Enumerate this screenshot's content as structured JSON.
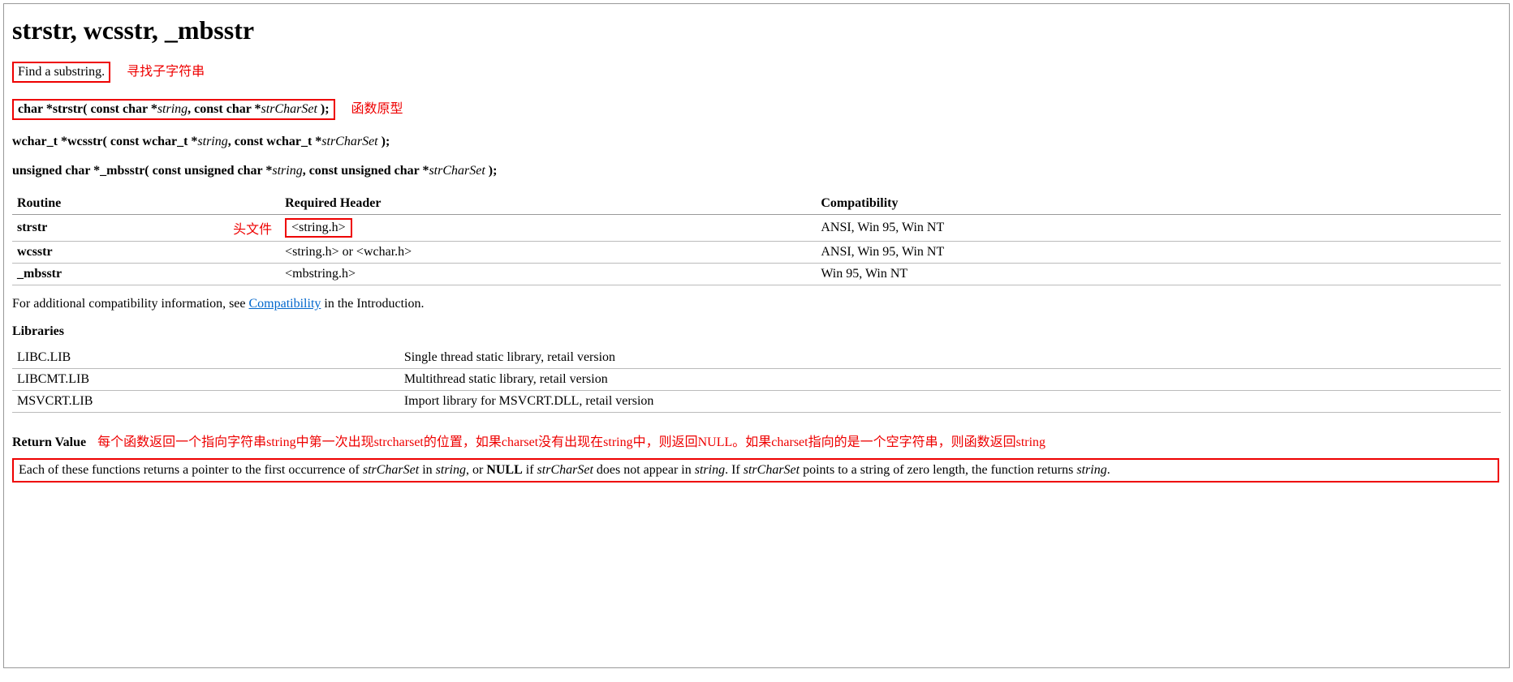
{
  "title": "strstr, wcsstr, _mbsstr",
  "summary": "Find a substring.",
  "summary_annot": "寻找子字符串",
  "proto1": {
    "prefix": "char *strstr( const char *",
    "p1": "string",
    "mid": ", const char *",
    "p2": "strCharSet",
    "suffix": " );"
  },
  "proto1_annot": "函数原型",
  "proto2": {
    "prefix": "wchar_t *wcsstr( const wchar_t *",
    "p1": "string",
    "mid": ", const wchar_t *",
    "p2": "strCharSet",
    "suffix": " );"
  },
  "proto3": {
    "prefix": "unsigned char *_mbsstr( const unsigned char *",
    "p1": "string",
    "mid": ", const unsigned char *",
    "p2": "strCharSet",
    "suffix": " );"
  },
  "header_table": {
    "cols": [
      "Routine",
      "Required Header",
      "Compatibility"
    ],
    "rows": [
      {
        "routine": "strstr",
        "header": "<string.h>",
        "header_annot": "头文件",
        "compat": "ANSI, Win 95, Win NT"
      },
      {
        "routine": "wcsstr",
        "header": "<string.h> or <wchar.h>",
        "compat": "ANSI, Win 95, Win NT"
      },
      {
        "routine": "_mbsstr",
        "header": "<mbstring.h>",
        "compat": "Win 95, Win NT"
      }
    ]
  },
  "compat_sentence_pre": "For additional compatibility information, see ",
  "compat_link": "Compatibility",
  "compat_sentence_post": " in the Introduction.",
  "libraries_head": "Libraries",
  "libraries": [
    {
      "name": "LIBC.LIB",
      "desc": "Single thread static library, retail version"
    },
    {
      "name": "LIBCMT.LIB",
      "desc": "Multithread static library, retail version"
    },
    {
      "name": "MSVCRT.LIB",
      "desc": "Import library for MSVCRT.DLL, retail version"
    }
  ],
  "return_head": "Return Value",
  "return_annot": "每个函数返回一个指向字符串string中第一次出现strcharset的位置，如果charset没有出现在string中，则返回NULL。如果charset指向的是一个空字符串，则函数返回string",
  "return_text": {
    "t1": "Each of these functions returns a pointer to the first occurrence of ",
    "i1": "strCharSet",
    "t2": " in ",
    "i2": "string",
    "t3": ", or ",
    "b1": "NULL",
    "t4": " if ",
    "i3": "strCharSet",
    "t5": " does not appear in ",
    "i4": "string",
    "t6": ". If ",
    "i5": "strCharSet",
    "t7": " points to a string of zero length, the function returns ",
    "i6": "string",
    "t8": "."
  }
}
